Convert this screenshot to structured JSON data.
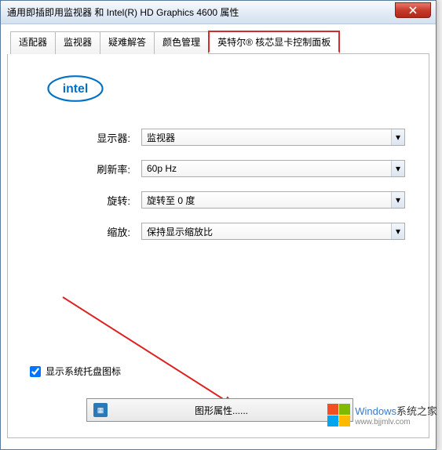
{
  "window": {
    "title": "通用即插即用监视器 和 Intel(R) HD Graphics 4600 属性"
  },
  "tabs": [
    {
      "label": "适配器"
    },
    {
      "label": "监视器"
    },
    {
      "label": "疑难解答"
    },
    {
      "label": "颜色管理"
    },
    {
      "label": "英特尔® 核芯显卡控制面板",
      "active": true
    }
  ],
  "logo": {
    "text": "intel"
  },
  "form": {
    "display": {
      "label": "显示器:",
      "value": "监视器"
    },
    "refresh": {
      "label": "刷新率:",
      "value": "60p Hz"
    },
    "rotation": {
      "label": "旋转:",
      "value": "旋转至 0 度"
    },
    "scaling": {
      "label": "缩放:",
      "value": "保持显示缩放比"
    }
  },
  "tray": {
    "label": "显示系统托盘图标",
    "checked": true
  },
  "graphics_button": {
    "label": "图形属性......"
  },
  "watermark": {
    "brand": "Windows",
    "brand_suffix": "系统之家",
    "url": "www.bjjmlv.com",
    "colors": [
      "#f25022",
      "#7fba00",
      "#00a4ef",
      "#ffb900"
    ]
  }
}
